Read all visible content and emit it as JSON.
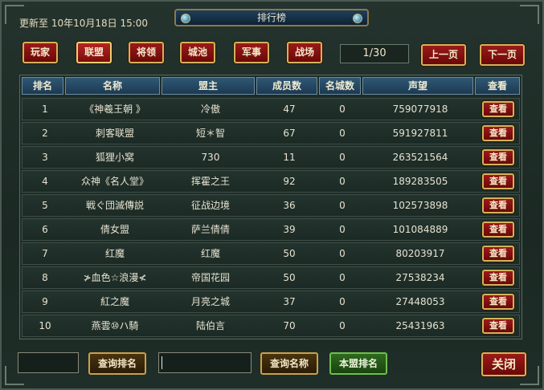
{
  "header": {
    "update_time": "更新至 10年10月18日 15:00",
    "title": "排行榜"
  },
  "tabs": [
    {
      "label": "玩家",
      "active": false
    },
    {
      "label": "联盟",
      "active": true
    },
    {
      "label": "将领",
      "active": false
    },
    {
      "label": "城池",
      "active": false
    },
    {
      "label": "军事",
      "active": false
    },
    {
      "label": "战场",
      "active": false
    }
  ],
  "pagination": {
    "page": "1/30",
    "prev_label": "上一页",
    "next_label": "下一页"
  },
  "table": {
    "columns": [
      "排名",
      "名称",
      "盟主",
      "成员数",
      "名城数",
      "声望",
      "查看"
    ],
    "view_label": "查看",
    "rows": [
      {
        "rank": "1",
        "name": "《神羲王朝 》",
        "leader": "冷傲",
        "members": "47",
        "cities": "0",
        "prestige": "759077918"
      },
      {
        "rank": "2",
        "name": "刺客联盟",
        "leader": "短＊智",
        "members": "67",
        "cities": "0",
        "prestige": "591927811"
      },
      {
        "rank": "3",
        "name": "狐狸小窝",
        "leader": "730",
        "members": "11",
        "cities": "0",
        "prestige": "263521564"
      },
      {
        "rank": "4",
        "name": "众神《名人堂》",
        "leader": "挥霍之王",
        "members": "92",
        "cities": "0",
        "prestige": "189283505"
      },
      {
        "rank": "5",
        "name": "戦ぐ団滅傳説",
        "leader": "征战边境",
        "members": "36",
        "cities": "0",
        "prestige": "102573898"
      },
      {
        "rank": "6",
        "name": "倩女盟",
        "leader": "萨兰倩倩",
        "members": "39",
        "cities": "0",
        "prestige": "101084889"
      },
      {
        "rank": "7",
        "name": "红魔",
        "leader": "红魔",
        "members": "50",
        "cities": "0",
        "prestige": "80203917"
      },
      {
        "rank": "8",
        "name": "≯血色☆浪漫≮",
        "leader": "帝国花园",
        "members": "50",
        "cities": "0",
        "prestige": "27538234"
      },
      {
        "rank": "9",
        "name": "紅之魔",
        "leader": "月亮之城",
        "members": "37",
        "cities": "0",
        "prestige": "27448053"
      },
      {
        "rank": "10",
        "name": "燕雲⑩ハ騎",
        "leader": "陆伯言",
        "members": "70",
        "cities": "0",
        "prestige": "25431963"
      }
    ]
  },
  "footer": {
    "rank_input_value": "",
    "query_rank_label": "查询排名",
    "name_input_value": "",
    "query_name_label": "查询名称",
    "own_rank_label": "本盟排名",
    "close_label": "关闭"
  }
}
